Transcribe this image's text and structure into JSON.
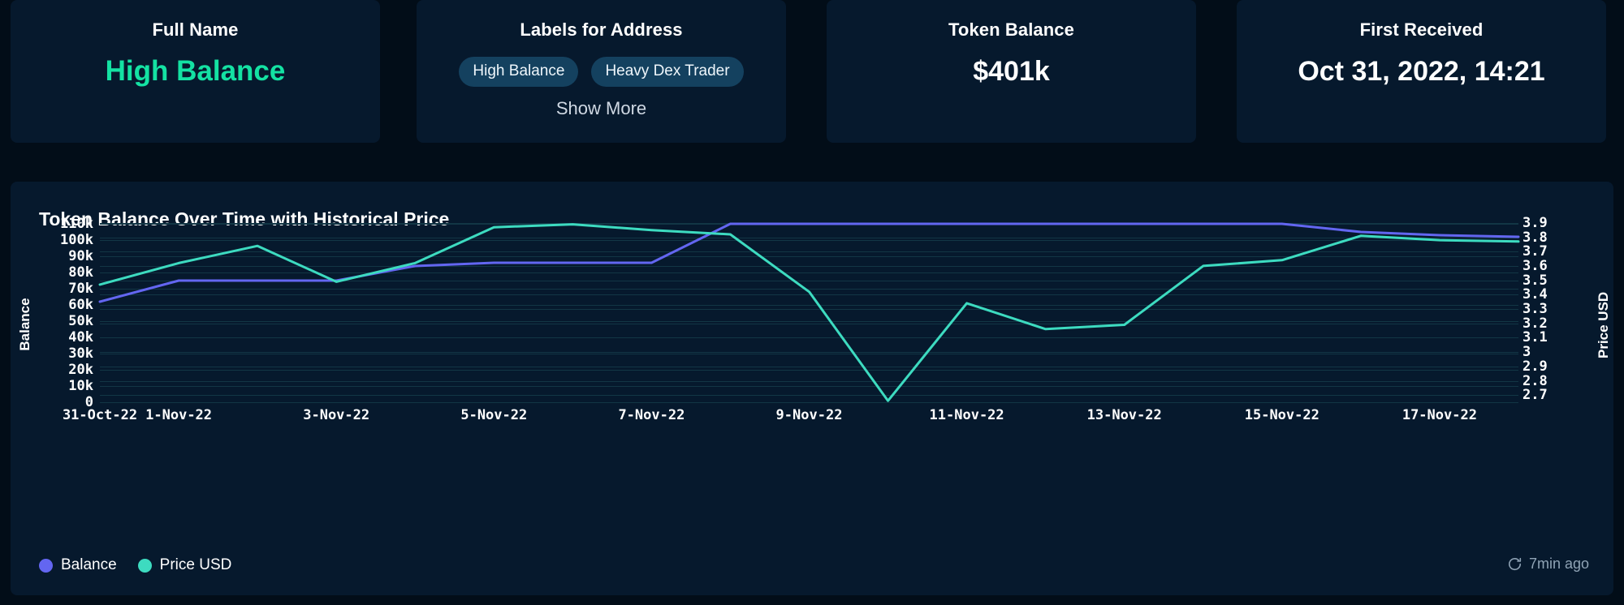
{
  "cards": [
    {
      "title": "Full Name",
      "value": "High Balance",
      "accent": true
    },
    {
      "title": "Labels for Address",
      "badges": [
        "High Balance",
        "Heavy Dex Trader"
      ],
      "show_more": "Show More"
    },
    {
      "title": "Token Balance",
      "value": "$401k"
    },
    {
      "title": "First Received",
      "value": "Oct 31, 2022, 14:21"
    }
  ],
  "chart_panel": {
    "heading": "Token Balance Over Time with Historical Price",
    "legend": [
      {
        "label": "Balance",
        "color": "#6366f1"
      },
      {
        "label": "Price USD",
        "color": "#3ddbc0"
      }
    ],
    "updated_text": "7min ago",
    "updated_icon": "refresh-clock-icon"
  },
  "chart_data": {
    "type": "line",
    "title": "Token Balance Over Time with Historical Price",
    "xlabel": "",
    "ylabel": "Balance",
    "y2label": "Price USD",
    "grid": true,
    "legend_position": "bottom-left",
    "ylim": [
      0,
      115000
    ],
    "y2lim": [
      2.65,
      3.95
    ],
    "yticks": [
      "0",
      "10k",
      "20k",
      "30k",
      "40k",
      "50k",
      "60k",
      "70k",
      "80k",
      "90k",
      "100k",
      "110k"
    ],
    "ytick_values": [
      0,
      10000,
      20000,
      30000,
      40000,
      50000,
      60000,
      70000,
      80000,
      90000,
      100000,
      110000
    ],
    "y2ticks": [
      "2.7",
      "2.8",
      "2.9",
      "3",
      "3.1",
      "3.2",
      "3.3",
      "3.4",
      "3.5",
      "3.6",
      "3.7",
      "3.8",
      "3.9"
    ],
    "y2tick_values": [
      2.7,
      2.8,
      2.9,
      3.0,
      3.1,
      3.2,
      3.3,
      3.4,
      3.5,
      3.6,
      3.7,
      3.8,
      3.9
    ],
    "xticks": [
      "31-Oct-22",
      "1-Nov-22",
      "3-Nov-22",
      "5-Nov-22",
      "7-Nov-22",
      "9-Nov-22",
      "11-Nov-22",
      "13-Nov-22",
      "15-Nov-22",
      "17-Nov-22"
    ],
    "xtick_index": [
      0,
      1,
      3,
      5,
      7,
      9,
      11,
      13,
      15,
      17
    ],
    "x": [
      "31-Oct-22",
      "1-Nov-22",
      "2-Nov-22",
      "3-Nov-22",
      "4-Nov-22",
      "5-Nov-22",
      "6-Nov-22",
      "7-Nov-22",
      "8-Nov-22",
      "9-Nov-22",
      "10-Nov-22",
      "11-Nov-22",
      "12-Nov-22",
      "13-Nov-22",
      "14-Nov-22",
      "15-Nov-22",
      "16-Nov-22",
      "17-Nov-22",
      "18-Nov-22"
    ],
    "series": [
      {
        "name": "Balance",
        "color": "#6366f1",
        "axis": "left",
        "values": [
          62000,
          75000,
          75000,
          75000,
          84000,
          86000,
          86000,
          86000,
          110000,
          110000,
          110000,
          110000,
          110000,
          110000,
          110000,
          110000,
          105000,
          103000,
          102000
        ]
      },
      {
        "name": "Price USD",
        "color": "#3ddbc0",
        "axis": "right",
        "values": [
          3.47,
          3.62,
          3.74,
          3.49,
          3.62,
          3.87,
          3.89,
          3.85,
          3.82,
          3.42,
          2.66,
          3.34,
          3.16,
          3.19,
          3.6,
          3.64,
          3.81,
          3.78,
          3.77
        ]
      }
    ]
  }
}
